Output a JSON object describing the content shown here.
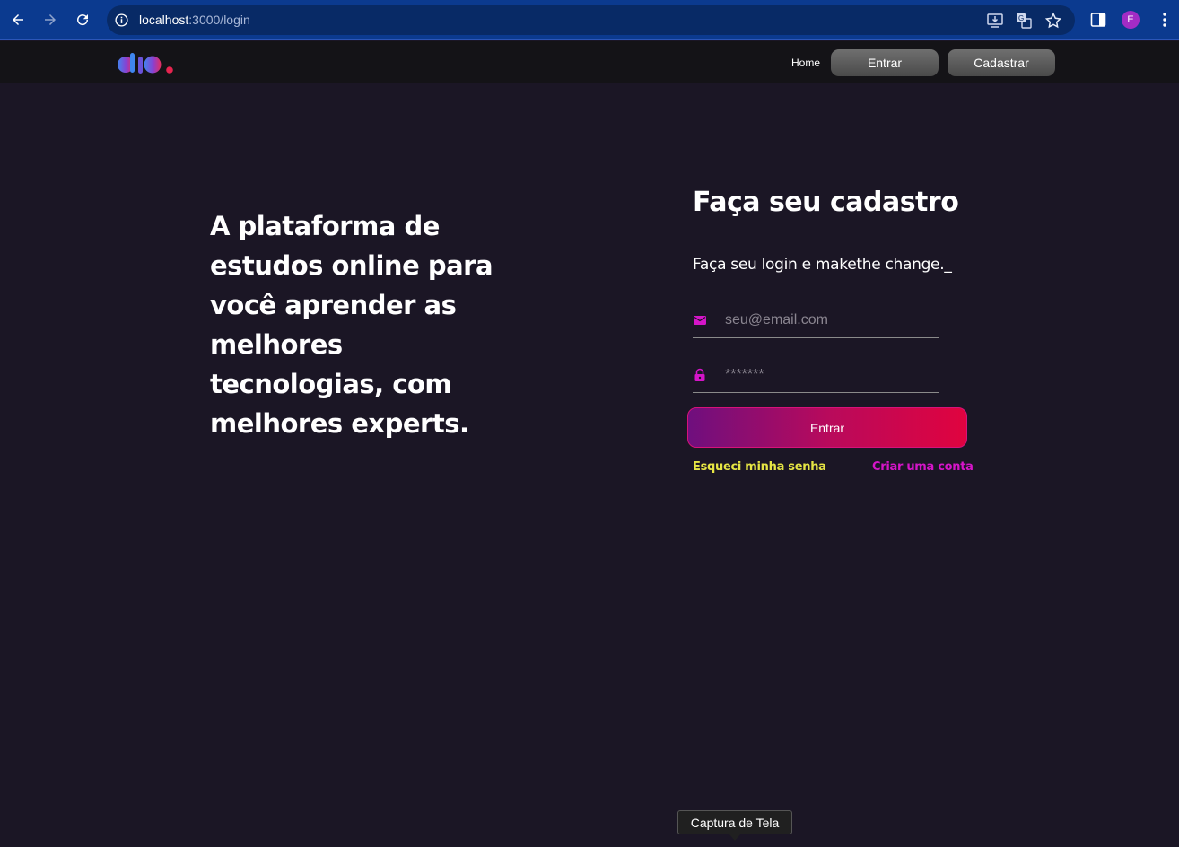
{
  "browser": {
    "url_host": "localhost",
    "url_path": ":3000/login",
    "profile_initial": "E",
    "icons": [
      "back-icon",
      "forward-icon",
      "reload-icon",
      "site-info-icon",
      "install-app-icon",
      "translate-icon",
      "bookmark-star-icon",
      "side-panel-icon",
      "menu-icon"
    ]
  },
  "header": {
    "logo_text": "dio.",
    "nav_home": "Home",
    "btn_login": "Entrar",
    "btn_signup": "Cadastrar"
  },
  "hero": {
    "headline": "A plataforma de estudos online para você aprender as melhores tecnologias, com melhores experts."
  },
  "form": {
    "title": "Faça seu cadastro",
    "subtitle": "Faça seu login e makethe change._",
    "email_placeholder": "seu@email.com",
    "password_placeholder": "*******",
    "submit_label": "Entrar",
    "forgot_link": "Esqueci minha senha",
    "create_link": "Criar uma conta"
  },
  "tooltip": {
    "text": "Captura de Tela"
  },
  "colors": {
    "page_bg": "#1b1625",
    "header_bg": "#141317",
    "accent_pink": "#d515c8",
    "accent_yellow": "#e6e544",
    "gradient_start": "#6f0f7e",
    "gradient_end": "#e0033f"
  }
}
